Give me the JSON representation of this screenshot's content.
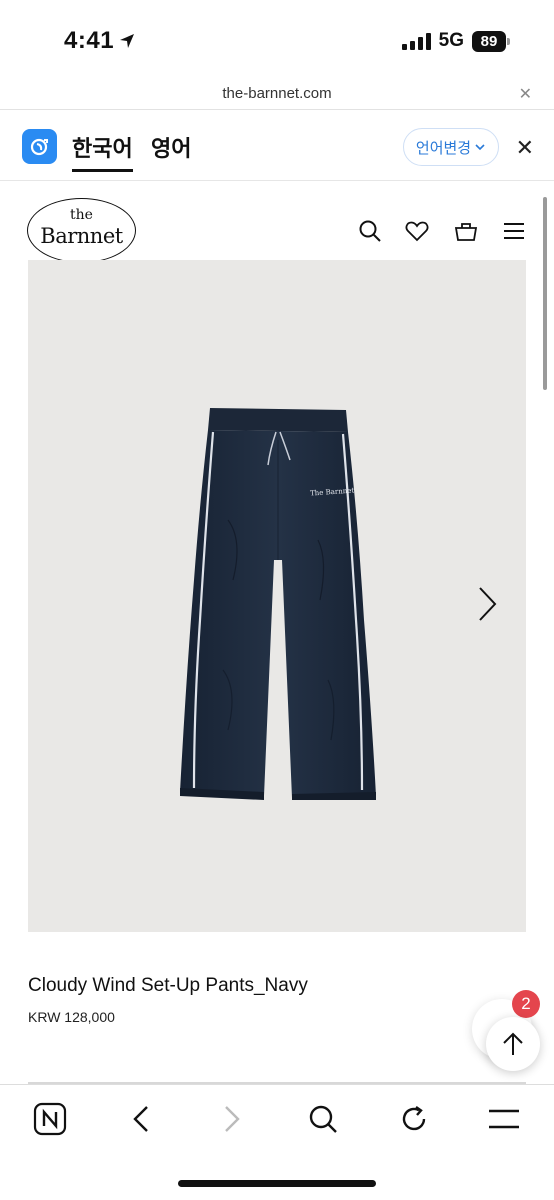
{
  "status_bar": {
    "time": "4:41",
    "network": "5G",
    "battery": "89"
  },
  "browser": {
    "url": "the-barnnet.com"
  },
  "translate_bar": {
    "tab_korean": "한국어",
    "tab_english": "영어",
    "change_language": "언어변경"
  },
  "site": {
    "logo_the": "the",
    "logo_brand": "Barnnet"
  },
  "product": {
    "title": "Cloudy Wind Set-Up Pants_Navy",
    "price": "KRW 128,000",
    "image_logo_text": "The Barnnet"
  },
  "notification": {
    "badge_count": "2"
  },
  "colors": {
    "accent_blue": "#2a8bf2",
    "badge_red": "#e4454d",
    "pants_navy": "#1f2b3c",
    "image_bg": "#e9e8e6"
  },
  "icons": {
    "header": [
      "search-icon",
      "heart-icon",
      "bag-icon",
      "menu-icon"
    ],
    "toolbar": [
      "naver-home-icon",
      "back-icon",
      "forward-icon",
      "search-icon",
      "refresh-icon",
      "menu-icon"
    ]
  }
}
